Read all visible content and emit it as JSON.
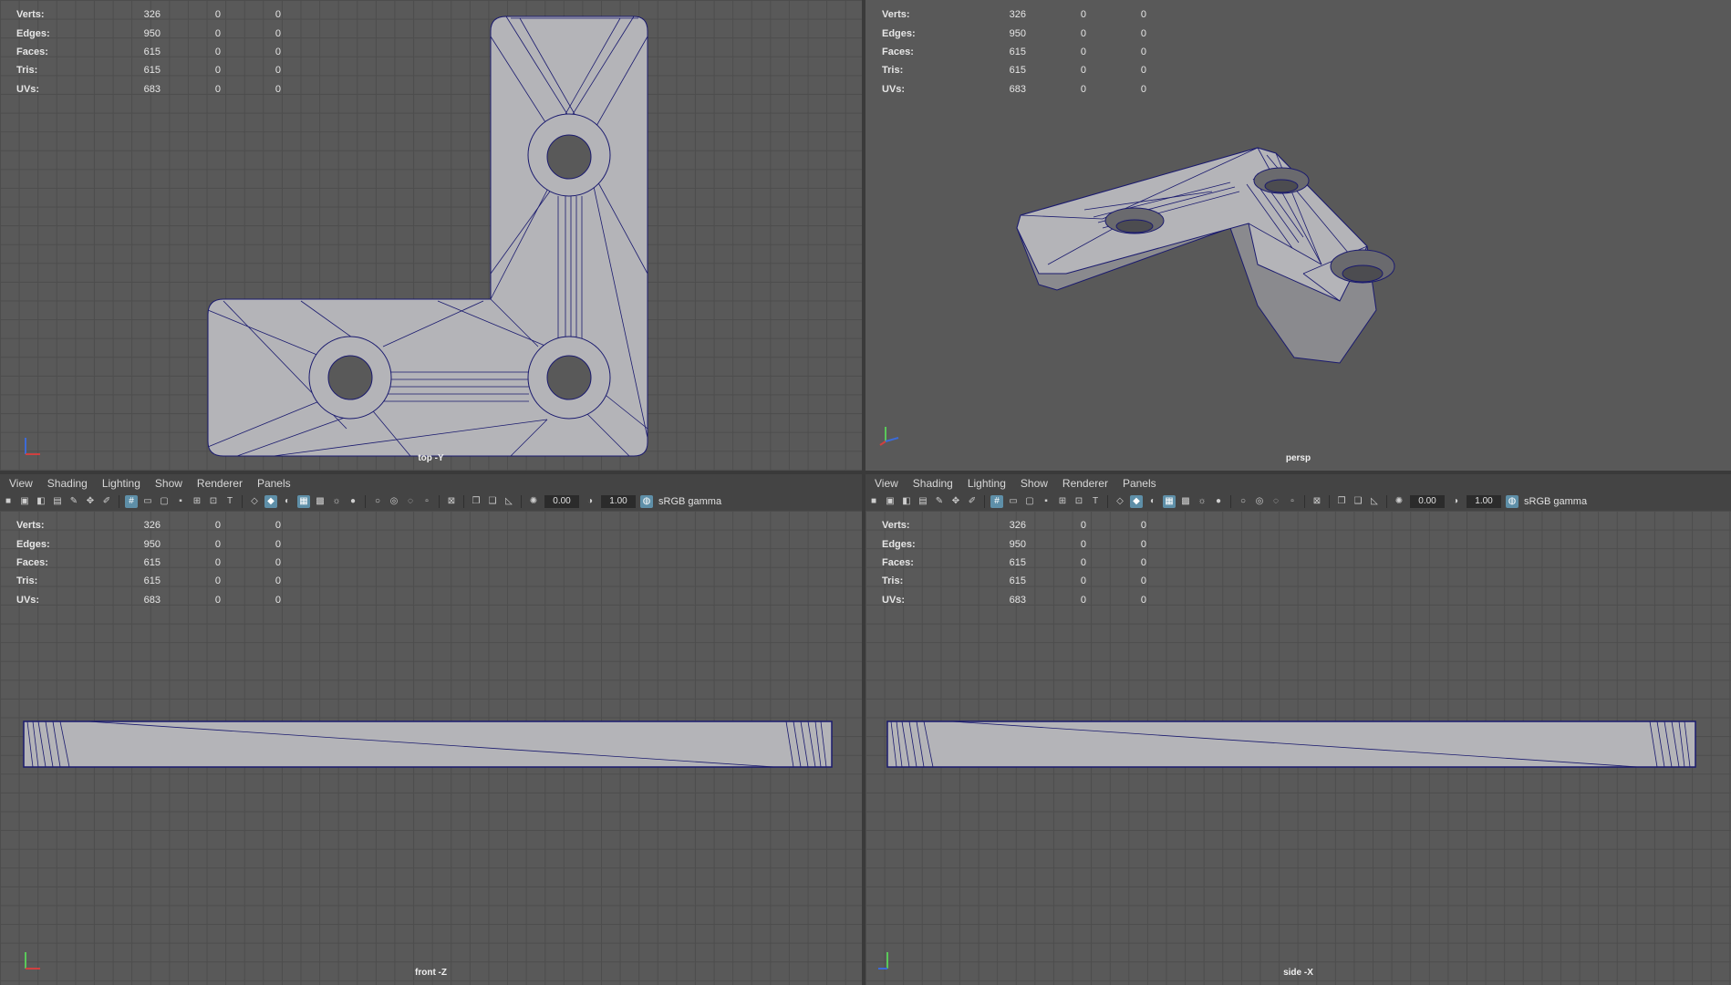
{
  "stats": {
    "rows": [
      {
        "label": "Verts:",
        "a": "326",
        "b": "0",
        "c": "0"
      },
      {
        "label": "Edges:",
        "a": "950",
        "b": "0",
        "c": "0"
      },
      {
        "label": "Faces:",
        "a": "615",
        "b": "0",
        "c": "0"
      },
      {
        "label": "Tris:",
        "a": "615",
        "b": "0",
        "c": "0"
      },
      {
        "label": "UVs:",
        "a": "683",
        "b": "0",
        "c": "0"
      }
    ]
  },
  "viewports": {
    "top": {
      "camera": "top -Y"
    },
    "persp": {
      "camera": "persp"
    },
    "front": {
      "camera": "front -Z"
    },
    "side": {
      "camera": "side -X"
    }
  },
  "menus": [
    "View",
    "Shading",
    "Lighting",
    "Show",
    "Renderer",
    "Panels"
  ],
  "toolbar": {
    "exposure": "0.00",
    "gamma_value": "1.00",
    "color_space": "sRGB gamma"
  },
  "icons": [
    "camera-icon",
    "grid-icon",
    "wireframe-icon",
    "smooth-shade-icon",
    "light-icon",
    "isolate-icon",
    "color-management-icon"
  ],
  "colors": {
    "wire": "#1a1a6e",
    "mesh_fill": "#b4b4b8",
    "viewport_bg": "#595959",
    "highlight": "#5e8fa8"
  }
}
